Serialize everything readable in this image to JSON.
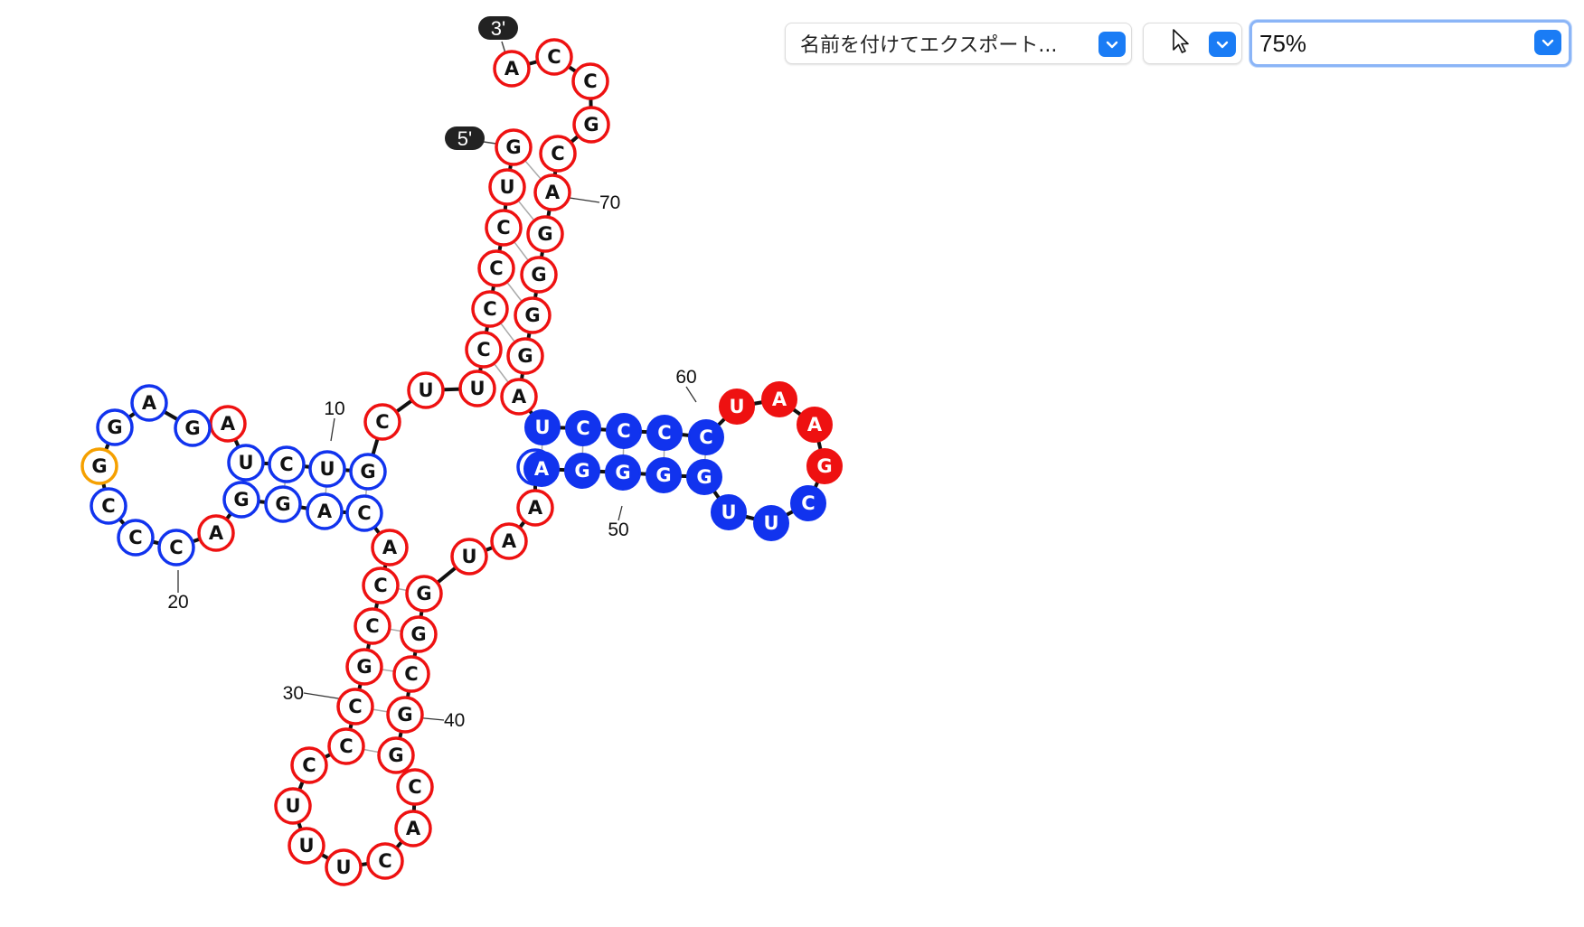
{
  "toolbar": {
    "export_label": "名前を付けてエクスポート...",
    "pointer_tool": "pointer-cursor-icon",
    "zoom_value": "75%"
  },
  "colors": {
    "red": "#ee1111",
    "blue": "#1133ee",
    "orange": "#f5a000",
    "accent": "#1a7cf5"
  },
  "rna": {
    "five_prime_label": "5'",
    "three_prime_label": "3'",
    "nucleotides": [
      {
        "i": 1,
        "base": "G",
        "color": "red",
        "filled": false
      },
      {
        "i": 2,
        "base": "U",
        "color": "red",
        "filled": false
      },
      {
        "i": 3,
        "base": "C",
        "color": "red",
        "filled": false
      },
      {
        "i": 4,
        "base": "C",
        "color": "red",
        "filled": false
      },
      {
        "i": 5,
        "base": "C",
        "color": "red",
        "filled": false
      },
      {
        "i": 6,
        "base": "C",
        "color": "red",
        "filled": false
      },
      {
        "i": 7,
        "base": "U",
        "color": "red",
        "filled": false
      },
      {
        "i": 8,
        "base": "U",
        "color": "red",
        "filled": false
      },
      {
        "i": 9,
        "base": "C",
        "color": "red",
        "filled": false
      },
      {
        "i": 10,
        "base": "G",
        "color": "blue",
        "filled": false
      },
      {
        "i": 11,
        "base": "U",
        "color": "blue",
        "filled": false
      },
      {
        "i": 12,
        "base": "C",
        "color": "blue",
        "filled": false
      },
      {
        "i": 13,
        "base": "U",
        "color": "blue",
        "filled": false
      },
      {
        "i": 14,
        "base": "A",
        "color": "red",
        "filled": false
      },
      {
        "i": 15,
        "base": "G",
        "color": "blue",
        "filled": false
      },
      {
        "i": 16,
        "base": "A",
        "color": "blue",
        "filled": false
      },
      {
        "i": 17,
        "base": "G",
        "color": "blue",
        "filled": false
      },
      {
        "i": 18,
        "base": "G",
        "color": "orange",
        "filled": false
      },
      {
        "i": 19,
        "base": "C",
        "color": "blue",
        "filled": false
      },
      {
        "i": 20,
        "base": "C",
        "color": "blue",
        "filled": false
      },
      {
        "i": 21,
        "base": "C",
        "color": "blue",
        "filled": false
      },
      {
        "i": 22,
        "base": "A",
        "color": "red",
        "filled": false
      },
      {
        "i": 23,
        "base": "G",
        "color": "blue",
        "filled": false
      },
      {
        "i": 24,
        "base": "G",
        "color": "blue",
        "filled": false
      },
      {
        "i": 25,
        "base": "A",
        "color": "blue",
        "filled": false
      },
      {
        "i": 26,
        "base": "C",
        "color": "blue",
        "filled": false
      },
      {
        "i": 27,
        "base": "A",
        "color": "red",
        "filled": false
      },
      {
        "i": 28,
        "base": "C",
        "color": "red",
        "filled": false
      },
      {
        "i": 29,
        "base": "C",
        "color": "red",
        "filled": false
      },
      {
        "i": 30,
        "base": "G",
        "color": "red",
        "filled": false
      },
      {
        "i": 31,
        "base": "C",
        "color": "red",
        "filled": false
      },
      {
        "i": 32,
        "base": "C",
        "color": "red",
        "filled": false
      },
      {
        "i": 33,
        "base": "C",
        "color": "red",
        "filled": false
      },
      {
        "i": 34,
        "base": "U",
        "color": "red",
        "filled": false
      },
      {
        "i": 35,
        "base": "U",
        "color": "red",
        "filled": false
      },
      {
        "i": 36,
        "base": "U",
        "color": "red",
        "filled": false
      },
      {
        "i": 37,
        "base": "C",
        "color": "red",
        "filled": false
      },
      {
        "i": 38,
        "base": "A",
        "color": "red",
        "filled": false
      },
      {
        "i": 39,
        "base": "C",
        "color": "red",
        "filled": false
      },
      {
        "i": 40,
        "base": "G",
        "color": "red",
        "filled": false
      },
      {
        "i": 41,
        "base": "G",
        "color": "red",
        "filled": false
      },
      {
        "i": 42,
        "base": "C",
        "color": "red",
        "filled": false
      },
      {
        "i": 43,
        "base": "G",
        "color": "red",
        "filled": false
      },
      {
        "i": 44,
        "base": "G",
        "color": "red",
        "filled": false
      },
      {
        "i": 45,
        "base": "U",
        "color": "red",
        "filled": false
      },
      {
        "i": 46,
        "base": "A",
        "color": "red",
        "filled": false
      },
      {
        "i": 47,
        "base": "A",
        "color": "red",
        "filled": false
      },
      {
        "i": 48,
        "base": "C",
        "color": "blue",
        "filled": false
      },
      {
        "i": 49,
        "base": "A",
        "color": "blue",
        "filled": true
      },
      {
        "i": 50,
        "base": "G",
        "color": "blue",
        "filled": true
      },
      {
        "i": 51,
        "base": "G",
        "color": "blue",
        "filled": true
      },
      {
        "i": 52,
        "base": "G",
        "color": "blue",
        "filled": true
      },
      {
        "i": 53,
        "base": "G",
        "color": "blue",
        "filled": true
      },
      {
        "i": 54,
        "base": "U",
        "color": "blue",
        "filled": true
      },
      {
        "i": 55,
        "base": "U",
        "color": "blue",
        "filled": true
      },
      {
        "i": 56,
        "base": "C",
        "color": "blue",
        "filled": true
      },
      {
        "i": 57,
        "base": "G",
        "color": "red",
        "filled": true
      },
      {
        "i": 58,
        "base": "A",
        "color": "red",
        "filled": true
      },
      {
        "i": 59,
        "base": "A",
        "color": "red",
        "filled": true
      },
      {
        "i": 60,
        "base": "U",
        "color": "red",
        "filled": true
      },
      {
        "i": 61,
        "base": "C",
        "color": "blue",
        "filled": true
      },
      {
        "i": 62,
        "base": "C",
        "color": "blue",
        "filled": true
      },
      {
        "i": 63,
        "base": "C",
        "color": "blue",
        "filled": true
      },
      {
        "i": 64,
        "base": "C",
        "color": "blue",
        "filled": true
      },
      {
        "i": 65,
        "base": "U",
        "color": "blue",
        "filled": true
      },
      {
        "i": 66,
        "base": "A",
        "color": "red",
        "filled": false
      },
      {
        "i": 67,
        "base": "G",
        "color": "red",
        "filled": false
      },
      {
        "i": 68,
        "base": "G",
        "color": "red",
        "filled": false
      },
      {
        "i": 69,
        "base": "G",
        "color": "red",
        "filled": false
      },
      {
        "i": 70,
        "base": "G",
        "color": "red",
        "filled": false
      },
      {
        "i": 71,
        "base": "A",
        "color": "red",
        "filled": false
      },
      {
        "i": 72,
        "base": "C",
        "color": "red",
        "filled": false
      },
      {
        "i": 73,
        "base": "G",
        "color": "red",
        "filled": false
      },
      {
        "i": 74,
        "base": "C",
        "color": "red",
        "filled": false
      },
      {
        "i": 75,
        "base": "C",
        "color": "red",
        "filled": false
      },
      {
        "i": 76,
        "base": "A",
        "color": "red",
        "filled": false
      }
    ],
    "pairs": [
      [
        1,
        71
      ],
      [
        2,
        70
      ],
      [
        3,
        69
      ],
      [
        4,
        68
      ],
      [
        5,
        67
      ],
      [
        6,
        66
      ],
      [
        10,
        26
      ],
      [
        11,
        25
      ],
      [
        12,
        24
      ],
      [
        13,
        23
      ],
      [
        28,
        44
      ],
      [
        29,
        43
      ],
      [
        30,
        42
      ],
      [
        31,
        41
      ],
      [
        32,
        40
      ],
      [
        49,
        65
      ],
      [
        50,
        64
      ],
      [
        51,
        63
      ],
      [
        52,
        62
      ],
      [
        53,
        61
      ]
    ],
    "number_labels": [
      {
        "i": 10,
        "text": "10"
      },
      {
        "i": 20,
        "text": "20"
      },
      {
        "i": 30,
        "text": "30"
      },
      {
        "i": 40,
        "text": "40"
      },
      {
        "i": 50,
        "text": "50"
      },
      {
        "i": 60,
        "text": "60"
      },
      {
        "i": 70,
        "text": "70"
      }
    ]
  }
}
